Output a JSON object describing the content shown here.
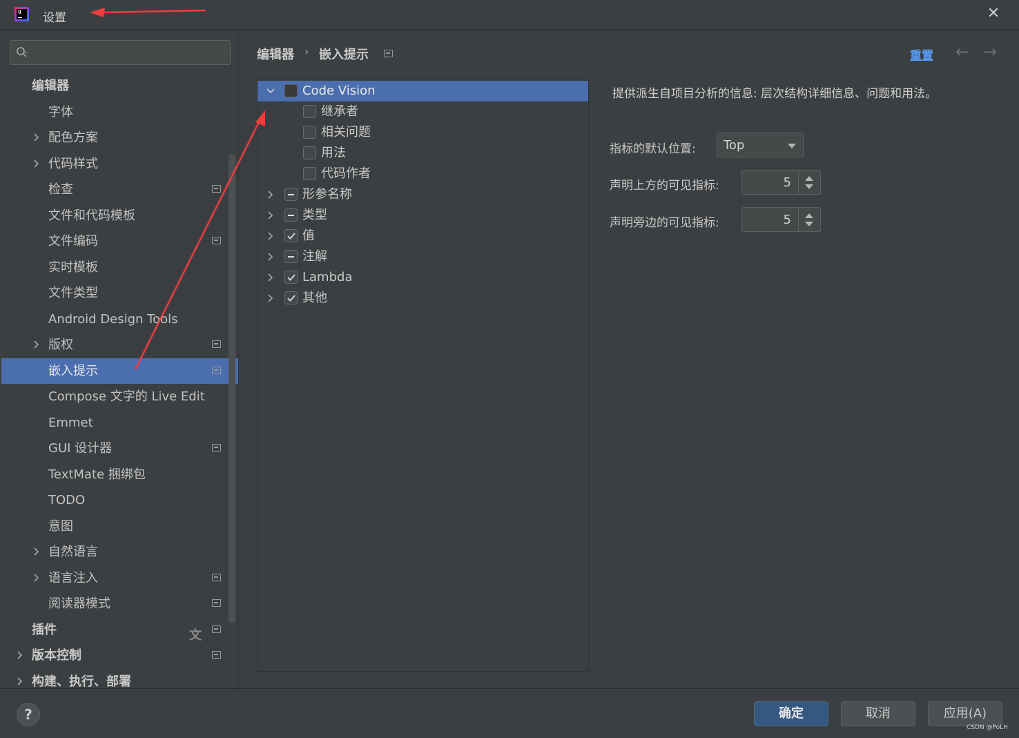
{
  "window": {
    "title": "设置",
    "close_label": "✕"
  },
  "sidebar": {
    "search_placeholder": "",
    "items": [
      {
        "label": "编辑器"
      },
      {
        "label": "字体"
      },
      {
        "label": "配色方案"
      },
      {
        "label": "代码样式"
      },
      {
        "label": "检查"
      },
      {
        "label": "文件和代码模板"
      },
      {
        "label": "文件编码"
      },
      {
        "label": "实时模板"
      },
      {
        "label": "文件类型"
      },
      {
        "label": "Android Design Tools"
      },
      {
        "label": "版权"
      },
      {
        "label": "嵌入提示"
      },
      {
        "label": "Compose 文字的 Live Edit"
      },
      {
        "label": "Emmet"
      },
      {
        "label": "GUI 设计器"
      },
      {
        "label": "TextMate 捆绑包"
      },
      {
        "label": "TODO"
      },
      {
        "label": "意图"
      },
      {
        "label": "自然语言"
      },
      {
        "label": "语言注入"
      },
      {
        "label": "阅读器模式"
      },
      {
        "label": "插件"
      },
      {
        "label": "版本控制"
      },
      {
        "label": "构建、执行、部署"
      }
    ]
  },
  "header": {
    "breadcrumb": [
      "编辑器",
      "嵌入提示"
    ],
    "separator": "›",
    "reset_label": "重置",
    "back_label": "←",
    "forward_label": "→"
  },
  "hints_tree": [
    {
      "label": "Code Vision",
      "state": "unchecked"
    },
    {
      "label": "继承者",
      "state": "unchecked"
    },
    {
      "label": "相关问题",
      "state": "unchecked"
    },
    {
      "label": "用法",
      "state": "unchecked"
    },
    {
      "label": "代码作者",
      "state": "unchecked"
    },
    {
      "label": "形参名称",
      "state": "mixed"
    },
    {
      "label": "类型",
      "state": "mixed"
    },
    {
      "label": "值",
      "state": "checked"
    },
    {
      "label": "注解",
      "state": "mixed"
    },
    {
      "label": "Lambda",
      "state": "checked"
    },
    {
      "label": "其他",
      "state": "checked"
    }
  ],
  "details": {
    "description": "提供派生自项目分析的信息: 层次结构详细信息、问题和用法。",
    "default_position_label": "指标的默认位置:",
    "default_position_value": "Top",
    "above_label": "声明上方的可见指标:",
    "above_value": "5",
    "beside_label": "声明旁边的可见指标:",
    "beside_value": "5"
  },
  "footer": {
    "help_label": "?",
    "ok_label": "确定",
    "cancel_label": "取消",
    "apply_label": "应用(A)",
    "watermark": "CSDN @PoLH"
  },
  "colors": {
    "background": "#3c3f41",
    "selection": "#4b6eaf",
    "link": "#589df6",
    "primary_button": "#365880",
    "annotation_arrow": "#f03c3c"
  }
}
